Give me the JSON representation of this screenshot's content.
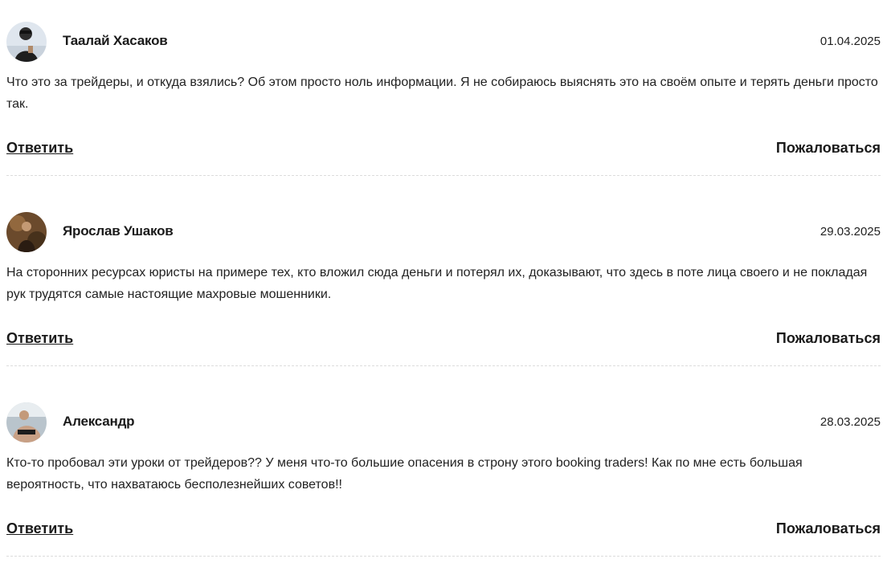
{
  "comments": [
    {
      "author": "Таалай Хасаков",
      "date": "01.04.2025",
      "text": "Что это за трейдеры, и откуда взялись? Об этом просто ноль информации. Я не собираюсь выяснять это на своём опыте и терять деньги просто так.",
      "reply_label": "Ответить",
      "report_label": "Пожаловаться"
    },
    {
      "author": "Ярослав Ушаков",
      "date": "29.03.2025",
      "text": "На сторонних ресурсах юристы на примере тех, кто вложил сюда деньги и потерял их, доказывают, что здесь в поте лица своего и не покладая рук трудятся самые настоящие махровые мошенники.",
      "reply_label": "Ответить",
      "report_label": "Пожаловаться"
    },
    {
      "author": "Александр",
      "date": "28.03.2025",
      "text": "Кто-то пробовал эти уроки от трейдеров?? У меня что-то большие опасения в строну этого booking traders! Как по мне есть большая вероятность, что нахватаюсь бесполезнейших советов!!",
      "reply_label": "Ответить",
      "report_label": "Пожаловаться"
    }
  ]
}
